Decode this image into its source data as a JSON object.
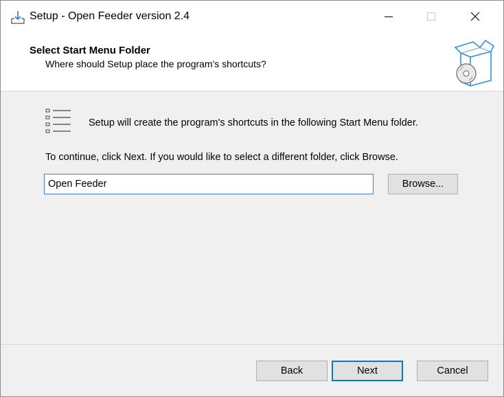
{
  "window": {
    "title": "Setup - Open Feeder version 2.4",
    "icons": {
      "app": "setup-download-icon",
      "minimize": "minimize-icon",
      "maximize": "maximize-icon",
      "close": "close-icon"
    }
  },
  "header": {
    "title": "Select Start Menu Folder",
    "subtitle": "Where should Setup place the program's shortcuts?",
    "image_icon": "box-with-disc-icon"
  },
  "body": {
    "list_icon": "list-icon",
    "info_text": "Setup will create the program's shortcuts in the following Start Menu folder.",
    "instruction_text": "To continue, click Next. If you would like to select a different folder, click Browse.",
    "folder_value": "Open Feeder",
    "browse_label": "Browse..."
  },
  "footer": {
    "back_label": "Back",
    "next_label": "Next",
    "cancel_label": "Cancel"
  },
  "colors": {
    "accent": "#0078d7",
    "input_border": "#3c7fd3",
    "button_face": "#e1e1e1",
    "panel_bg": "#f0f0f0"
  }
}
